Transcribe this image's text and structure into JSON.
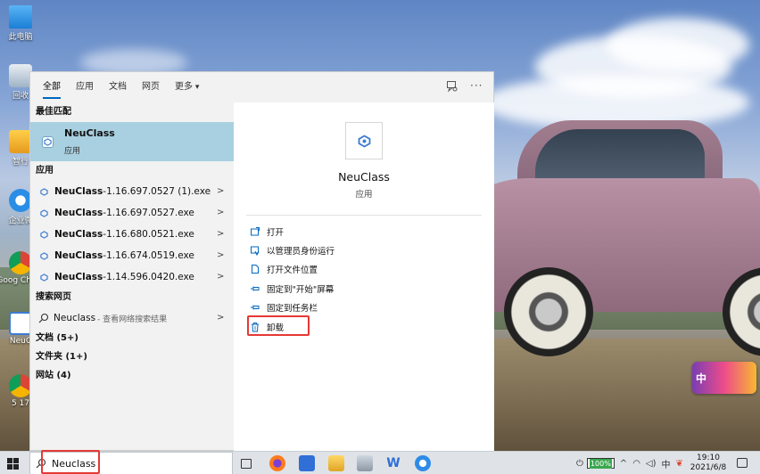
{
  "desktop": {
    "icons": [
      {
        "label": "此电脑"
      },
      {
        "label": "回收"
      },
      {
        "label": "智行"
      },
      {
        "label": "企业微"
      },
      {
        "label": "Goog Chron"
      },
      {
        "label": "NeuC"
      },
      {
        "label": "5 17"
      }
    ],
    "sticker_label": "中"
  },
  "search_panel": {
    "tabs": [
      {
        "label": "全部",
        "active": true
      },
      {
        "label": "应用"
      },
      {
        "label": "文档"
      },
      {
        "label": "网页"
      },
      {
        "label": "更多"
      }
    ],
    "more_options": "···",
    "best_match_header": "最佳匹配",
    "best_match": {
      "name": "NeuClass",
      "type": "应用"
    },
    "apps_header": "应用",
    "apps": [
      {
        "bold": "NeuClass",
        "rest": "-1.16.697.0527 (1).exe"
      },
      {
        "bold": "NeuClass",
        "rest": "-1.16.697.0527.exe"
      },
      {
        "bold": "NeuClass",
        "rest": "-1.16.680.0521.exe"
      },
      {
        "bold": "NeuClass",
        "rest": "-1.16.674.0519.exe"
      },
      {
        "bold": "NeuClass",
        "rest": "-1.14.596.0420.exe"
      }
    ],
    "web_header": "搜索网页",
    "web_result": {
      "name": "Neuclass",
      "suffix": "- 查看网络搜索结果"
    },
    "documents_header": "文档 (5+)",
    "folders_header": "文件夹 (1+)",
    "websites_header": "网站 (4)"
  },
  "detail": {
    "name": "NeuClass",
    "type": "应用",
    "actions": [
      {
        "label": "打开",
        "icon": "open-icon"
      },
      {
        "label": "以管理员身份运行",
        "icon": "run-as-admin-icon"
      },
      {
        "label": "打开文件位置",
        "icon": "file-location-icon"
      },
      {
        "label": "固定到\"开始\"屏幕",
        "icon": "pin-start-icon"
      },
      {
        "label": "固定到任务栏",
        "icon": "pin-taskbar-icon"
      },
      {
        "label": "卸载",
        "icon": "trash-icon"
      }
    ]
  },
  "taskbar": {
    "search_value": "Neuclass",
    "battery": "100%",
    "ime": "中",
    "time": "19:10",
    "date": "2021/6/8"
  },
  "colors": {
    "accent": "#0067c0",
    "best_match_bg": "#a8d0e0",
    "highlight_box": "#e53935"
  }
}
